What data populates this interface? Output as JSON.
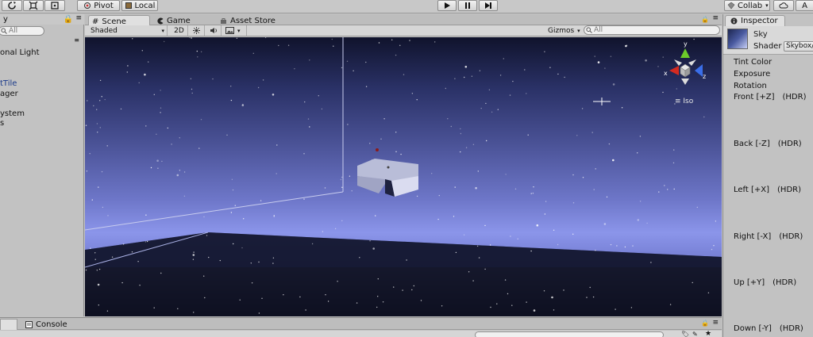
{
  "toolbar": {
    "pivot_label": "Pivot",
    "local_label": "Local",
    "collab_label": "Collab",
    "collab_caret": "▾",
    "account_label": "A"
  },
  "hierarchy": {
    "tab_label": "y",
    "search_placeholder": "All",
    "items": [
      "onal Light",
      "",
      "tTile",
      "ager",
      "",
      "ystem",
      "s"
    ]
  },
  "scene": {
    "tabs": [
      {
        "label": "Scene",
        "icon": "hash-icon"
      },
      {
        "label": "Game",
        "icon": "pacman-icon"
      },
      {
        "label": "Asset Store",
        "icon": "store-icon"
      }
    ],
    "shading_mode": "Shaded",
    "mode_2d": "2D",
    "gizmos_label": "Gizmos",
    "search_placeholder": "All",
    "projection_label": "Iso"
  },
  "inspector": {
    "tab_label": "Inspector",
    "object_name": "Sky",
    "shader_label": "Shader",
    "shader_value": "Skybox/",
    "properties": [
      {
        "label": "Tint Color",
        "hdr": ""
      },
      {
        "label": "Exposure",
        "hdr": ""
      },
      {
        "label": "Rotation",
        "hdr": ""
      },
      {
        "label": "Front [+Z]",
        "hdr": "(HDR)"
      },
      {
        "label": "Back [-Z]",
        "hdr": "(HDR)"
      },
      {
        "label": "Left [+X]",
        "hdr": "(HDR)"
      },
      {
        "label": "Right [-X]",
        "hdr": "(HDR)"
      },
      {
        "label": "Up [+Y]",
        "hdr": "(HDR)"
      },
      {
        "label": "Down [-Y]",
        "hdr": "(HDR)"
      }
    ]
  },
  "console": {
    "tab_label": "Console"
  },
  "gizmo": {
    "x_label": "x",
    "y_label": "y",
    "z_label": "z"
  },
  "colors": {
    "gizmo_x": "#d42a20",
    "gizmo_y": "#6ccc2a",
    "gizmo_z": "#3a6ee8"
  }
}
